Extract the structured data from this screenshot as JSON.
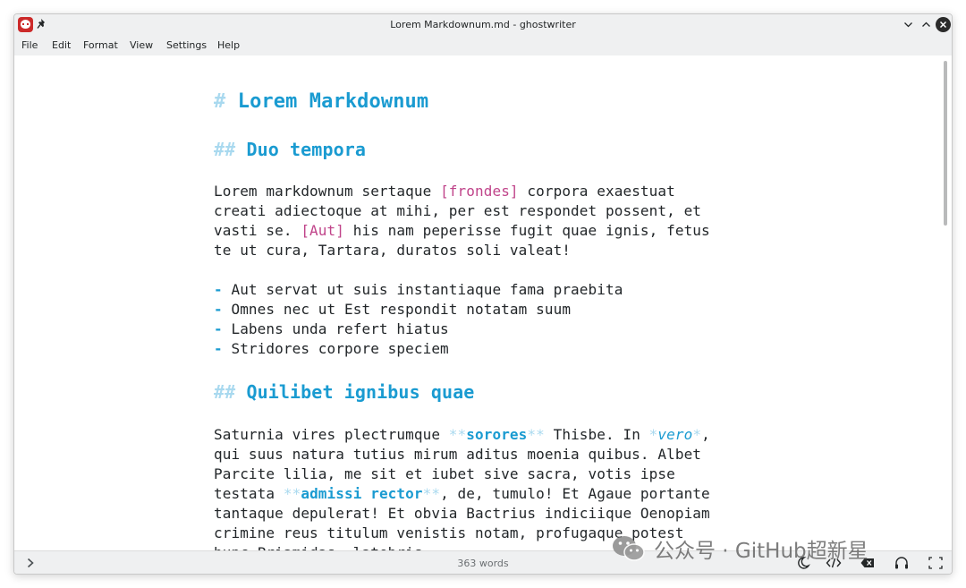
{
  "titlebar": {
    "title": "Lorem Markdownum.md - ghostwriter"
  },
  "menu": {
    "items": [
      "File",
      "Edit",
      "Format",
      "View",
      "Settings",
      "Help"
    ]
  },
  "editor": {
    "h1_mark": "#",
    "h1_text": "Lorem Markdownum",
    "h2_mark": "##",
    "h2a_text": "Duo tempora",
    "p1": {
      "l1a": "Lorem markdownum sertaque ",
      "l1link": "[frondes]",
      "l1b": " corpora exaestuat",
      "l2": "creati adiectoque at mihi, per est respondet possent, et",
      "l3a": "vasti se. ",
      "l3link": "[Aut]",
      "l3b": " his nam peperisse fugit quae ignis, fetus",
      "l4": "te ut cura, Tartara, duratos soli valeat!"
    },
    "list_marker": "-",
    "list": [
      " Aut servat ut suis instantiaque fama praebita",
      " Omnes nec ut Est respondit notatam suum",
      " Labens unda refert hiatus",
      " Stridores corpore speciem"
    ],
    "h2b_text": "Quilibet ignibus quae",
    "p2": {
      "l1a": "Saturnia vires plectrumque ",
      "bold_mark": "**",
      "l1bold": "sorores",
      "l1b": " Thisbe. In ",
      "ital_mark": "*",
      "l1ital": "vero",
      "l1c": ",",
      "l2": "qui suus natura tutius mirum aditus moenia quibus. Albet",
      "l3": "Parcite lilia, me sit et iubet sive sacra, votis ipse",
      "l4a": "testata ",
      "l4bold": "admissi rector",
      "l4b": ", de, tumulo! Et Agaue portante",
      "l5": "tantaque depulerat! Et obvia Bactrius indiciique Oenopiam",
      "l6": "crimine reus titulum venistis notam, profugaque potest",
      "l7": "hunc Priamidas, latebris."
    }
  },
  "status": {
    "word_count": "363 words"
  },
  "watermark": {
    "text": "公众号 · GitHub超新星"
  },
  "icons": [
    "app-icon",
    "pin-icon",
    "minimize-icon",
    "maximize-icon",
    "close-icon",
    "chevron-right-icon",
    "moon-icon",
    "code-icon",
    "backspace-icon",
    "headphones-icon",
    "fullscreen-icon",
    "wechat-icon"
  ],
  "colors": {
    "heading": "#1a9bd1",
    "markup": "#a9d9ef",
    "link": "#c0448a",
    "text": "#222629",
    "chrome": "#eff0f1"
  }
}
